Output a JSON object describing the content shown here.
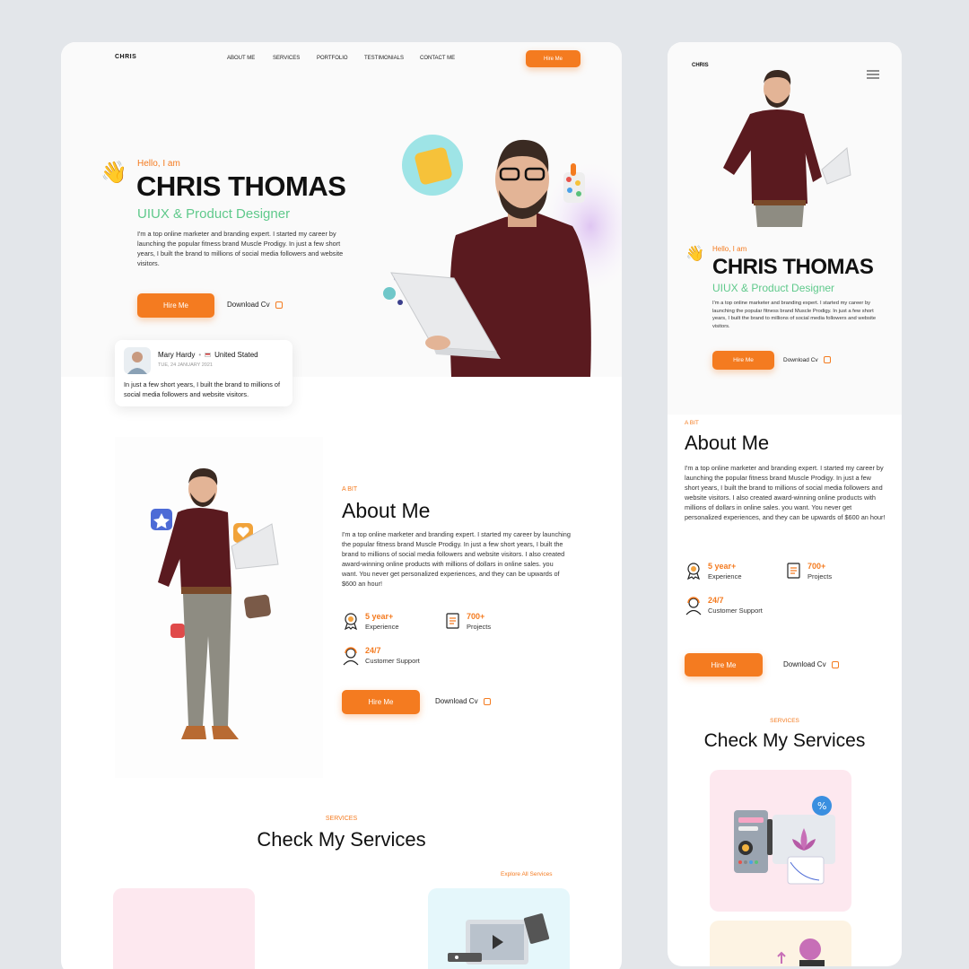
{
  "desktop": {
    "logo": "CHRIS",
    "nav": [
      "ABOUT ME",
      "SERVICES",
      "PORTFOLIO",
      "TESTIMONIALS",
      "CONTACT ME"
    ],
    "nav_hire": "Hire Me",
    "hero": {
      "hello": "Hello, I am",
      "name": "CHRIS THOMAS",
      "role": "UIUX & Product  Designer",
      "desc": "I'm a top online marketer and branding expert. I started my career by launching the popular fitness brand Muscle Prodigy. In just a few short years, I built the brand to millions of social media followers and website visitors.",
      "hire": "Hire Me",
      "download": "Download Cv"
    },
    "testimonial": {
      "name": "Mary Hardy",
      "country": "United Stated",
      "date": "TUE, 24 JANUARY 2021",
      "text": "In just a few short years, I built the brand to millions of social media followers and website visitors."
    },
    "about": {
      "kicker": "A BIT",
      "title": "About Me",
      "text": "I'm a top online marketer and branding expert. I started my career by launching the popular fitness brand Muscle Prodigy. In just a few short years, I built the brand to millions of social media followers and website visitors. I also created award-winning online products with millions of dollars in online sales. you want. You never get personalized experiences, and they can be upwards of $600 an hour!",
      "stats": [
        {
          "value": "5 year+",
          "label": "Experience"
        },
        {
          "value": "700+",
          "label": "Projects"
        },
        {
          "value": "24/7",
          "label": "Customer Support"
        }
      ],
      "hire": "Hire Me",
      "download": "Download Cv"
    },
    "services": {
      "kicker": "SERVICES",
      "title": "Check My Services",
      "explore": "Explore All Services"
    }
  },
  "mobile": {
    "logo": "CHRIS",
    "hero": {
      "hello": "Hello, I am",
      "name": "CHRIS THOMAS",
      "role": "UIUX & Product  Designer",
      "desc": "I'm a top online marketer and branding expert. I started my career by launching the popular fitness brand Muscle Prodigy. In just a few short years, I built the brand to millions of social media followers and website visitors.",
      "hire": "Hire Me",
      "download": "Download Cv"
    },
    "about": {
      "kicker": "A BIT",
      "title": "About Me",
      "text": "I'm a top online marketer and branding expert. I started my career by launching the popular fitness brand Muscle Prodigy. In just a few short years, I built the brand to millions of social media followers and website visitors. I also created award-winning online products with millions of dollars in online sales. you want. You never get personalized experiences, and they can be upwards of $600 an hour!",
      "stats": [
        {
          "value": "5 year+",
          "label": "Experience"
        },
        {
          "value": "700+",
          "label": "Projects"
        },
        {
          "value": "24/7",
          "label": "Customer Support"
        }
      ],
      "hire": "Hire Me",
      "download": "Download Cv"
    },
    "services": {
      "kicker": "SERVICES",
      "title": "Check My Services"
    }
  },
  "colors": {
    "accent": "#f47b20",
    "role_green": "#5fc98b",
    "page_bg": "#e3e6ea"
  }
}
